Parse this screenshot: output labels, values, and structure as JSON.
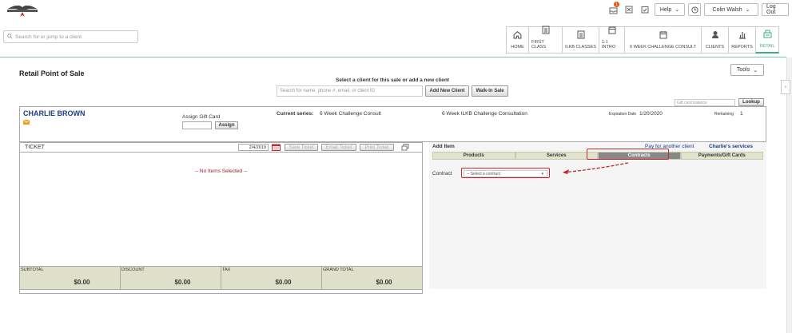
{
  "topbar": {
    "notif_count": "1",
    "help_label": "Help",
    "user_label": "Colin Walsh",
    "logout_label": "Log Out"
  },
  "search": {
    "placeholder": "Search for or jump to a client"
  },
  "nav": {
    "tabs": [
      {
        "label": "HOME",
        "icon": "home-icon"
      },
      {
        "label": "FIRST CLASS",
        "icon": "list-icon"
      },
      {
        "label": "ILKB CLASSES",
        "icon": "list-icon"
      },
      {
        "label": "1:1 INTRO",
        "icon": "calendar-icon"
      },
      {
        "label": "6 WEEK CHALLENGE CONSULT",
        "icon": "calendar-icon"
      },
      {
        "label": "CLIENTS",
        "icon": "person-icon"
      },
      {
        "label": "REPORTS",
        "icon": "bar-chart-icon"
      },
      {
        "label": "RETAIL",
        "icon": "register-icon"
      }
    ]
  },
  "page": {
    "title": "Retail Point of Sale",
    "tools_label": "Tools",
    "select_client_prompt": "Select a client for this sale or add a new client",
    "client_search_placeholder": "Search for name, phone #, email, or client ID",
    "add_new_client_label": "Add New Client",
    "walk_in_label": "Walk-In Sale",
    "gift_balance_placeholder": "Gift card balance",
    "lookup_label": "Lookup"
  },
  "client": {
    "name": "CHARLIE BROWN",
    "assign_gift_label": "Assign Gift Card",
    "assign_btn": "Assign",
    "series_label": "Current series:",
    "series_value": "6 Week Challenge Consult",
    "series_value2": "6 Week ILKB Challenge Consultation",
    "expiration_label": "Expiration Date",
    "expiration_value": "1/20/2020",
    "remaining_label": "Remaining",
    "remaining_value": "1"
  },
  "ticket": {
    "title": "TICKET",
    "date": "2/4/2019",
    "save_label": "Save Ticket",
    "email_label": "Email Ticket",
    "print_label": "Print Ticket",
    "empty_msg": "-- No Items Selected --",
    "totals": [
      {
        "label": "SUBTOTAL",
        "value": "$0.00"
      },
      {
        "label": "DISCOUNT",
        "value": "$0.00"
      },
      {
        "label": "TAX",
        "value": "$0.00"
      },
      {
        "label": "GRAND TOTAL",
        "value": "$0.00"
      }
    ]
  },
  "additem": {
    "title": "Add Item",
    "pay_another": "Pay for another client",
    "clients_services": "Charlie's services",
    "tabs": [
      "Products",
      "Services",
      "Contracts",
      "Payments/Gift Cards"
    ],
    "contract_label": "Contract",
    "contract_select": "-- Select a contract"
  },
  "colors": {
    "accent": "#3fae8e",
    "client_name": "#1a3c8c",
    "annotation": "#c0282f",
    "empty_msg": "#9b1c2a"
  }
}
